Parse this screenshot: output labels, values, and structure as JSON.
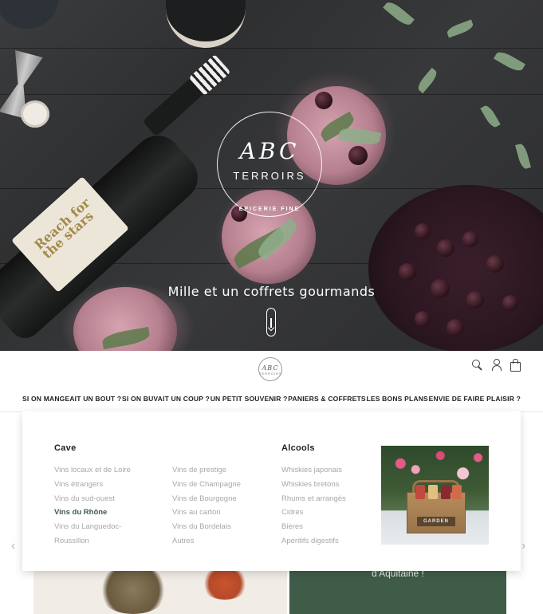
{
  "hero": {
    "logo_title": "ABC",
    "logo_subtitle": "TERROIRS",
    "logo_caption": "ÉPICERIE FINE",
    "bottle_label": "Reach for the stars",
    "tagline": "Mille et un coffrets gourmands"
  },
  "header": {
    "logo_title": "ABC",
    "logo_subtitle": "TERROIRS",
    "icons": [
      "search-icon",
      "user-icon",
      "bag-icon"
    ]
  },
  "nav": {
    "items": [
      {
        "label": "SI ON MANGEAIT UN BOUT ?",
        "active": false
      },
      {
        "label": "SI ON BUVAIT UN COUP ?",
        "active": true
      },
      {
        "label": "UN PETIT SOUVENIR ?",
        "active": false
      },
      {
        "label": "PANIERS & COFFRETS",
        "active": false
      },
      {
        "label": "LES BONS PLANS",
        "active": false
      },
      {
        "label": "ENVIE DE FAIRE PLAISIR ?",
        "active": false
      }
    ]
  },
  "megamenu": {
    "cave": {
      "heading": "Cave",
      "col1": [
        "Vins locaux et de Loire",
        "Vins étrangers",
        "Vins du sud-ouest",
        "Vins du Rhône",
        "Vins du Languedoc-",
        "Roussillon"
      ],
      "col2": [
        "Vins de prestige",
        "Vins de Champagne",
        "Vins de Bourgogne",
        "Vins au carton",
        "Vins du Bordelais",
        "Autres"
      ],
      "active_item": "Vins du Rhône"
    },
    "alcools": {
      "heading": "Alcools",
      "items": [
        "Whiskies japonais",
        "Whiskies bretons",
        "Rhums et arrangés",
        "Cidres",
        "Bières",
        "Apéritifs digestifs"
      ]
    },
    "promo_crate_label": "GARDEN"
  },
  "below": {
    "banner_text": "d'Aquitaine !"
  },
  "colors": {
    "accent_green": "#3f5c49",
    "menu_item_grey": "#a8a8a8"
  }
}
